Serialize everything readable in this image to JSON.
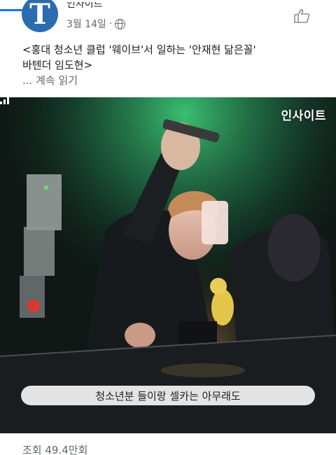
{
  "progress": {
    "fraction": 0.09,
    "color": "#1a73e8"
  },
  "post": {
    "page_initial": "T",
    "author_cropped": "인사이트",
    "date": "3월 14일",
    "separator": "·",
    "privacy_icon": "globe-icon",
    "save_icon": "bookmark-icon",
    "caption_line1": "<홍대 청소년 클럽 '웨이브'서 일하는 '안재현 닮은꼴'",
    "caption_line2": "바텐더 임도현>",
    "more_prefix": "...",
    "more_label": "계속 읽기"
  },
  "video": {
    "watermark": "인사이트",
    "subtitle": "청소년분 들이랑 셀카는 아무래도",
    "quality_icon": "signal-bars-icon"
  },
  "footer": {
    "views": "조회 49.4만회"
  },
  "colors": {
    "link_blue": "#1a73e8",
    "avatar_blue": "#2b6cb0",
    "meta_gray": "#65676b",
    "green_light": "#3fd27a"
  }
}
